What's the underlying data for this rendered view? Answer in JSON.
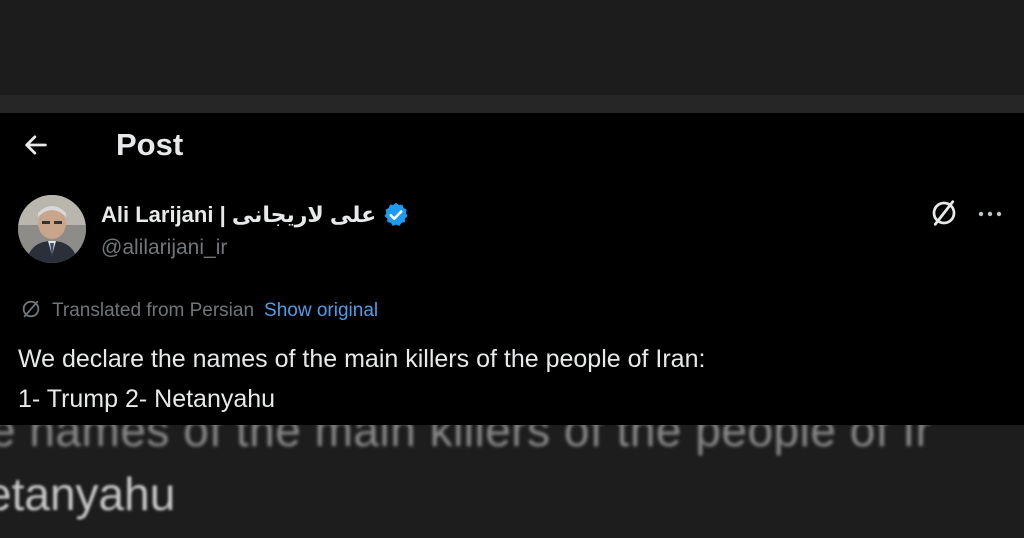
{
  "header": {
    "back_icon": "arrow-left-icon",
    "title": "Post"
  },
  "author": {
    "display_name": "Ali Larijani | علی لاریجانی",
    "handle": "@alilarijani_ir",
    "verified": true,
    "verified_color": "#1d9bf0"
  },
  "actions": {
    "translate_icon": "translate-icon",
    "more_icon": "more-horizontal-icon"
  },
  "translation": {
    "label": "Translated from Persian",
    "show_original": "Show original",
    "link_color": "#4c9ee8"
  },
  "post": {
    "line1": "We declare the names of the main killers of the people of Iran:",
    "line2": "1- Trump 2- Netanyahu"
  },
  "background_text": {
    "line1": "e names of the main killers of the people of Ir",
    "line2": "etanyahu"
  }
}
